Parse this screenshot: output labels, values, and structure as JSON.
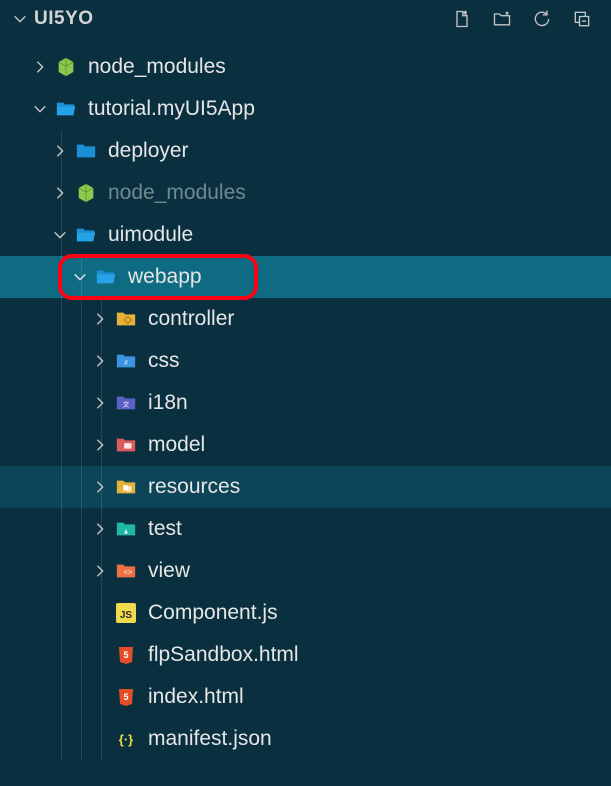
{
  "header": {
    "title": "UI5YO"
  },
  "tree": {
    "root": {
      "node_modules": "node_modules",
      "tutorial": "tutorial.myUI5App",
      "deployer": "deployer",
      "inner_node_modules": "node_modules",
      "uimodule": "uimodule",
      "webapp": "webapp",
      "controller": "controller",
      "css": "css",
      "i18n": "i18n",
      "model": "model",
      "resources": "resources",
      "test": "test",
      "view": "view",
      "component_js": "Component.js",
      "flp_sandbox": "flpSandbox.html",
      "index_html": "index.html",
      "manifest_json": "manifest.json"
    }
  }
}
